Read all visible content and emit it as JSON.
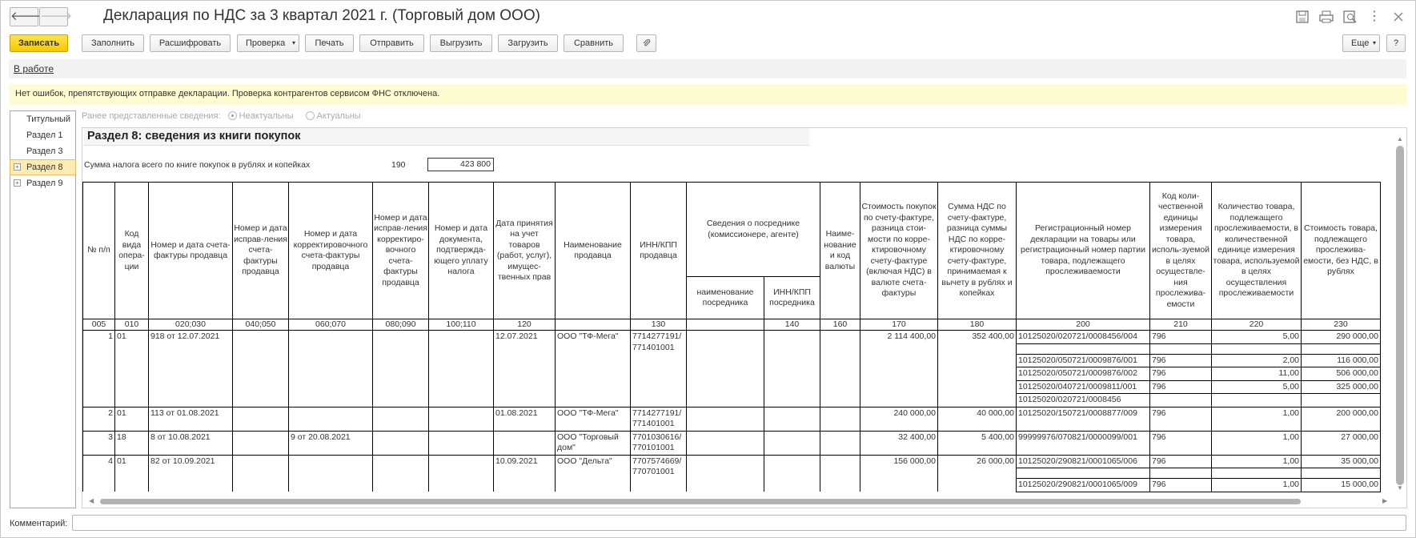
{
  "window": {
    "title": "Декларация по НДС за 3 квартал 2021 г. (Торговый дом ООО)",
    "back_glyph": "🡐",
    "forward_glyph": "🡒",
    "more_glyph": "⋮"
  },
  "toolbar": {
    "save": "Записать",
    "fill": "Заполнить",
    "decode": "Расшифровать",
    "check": "Проверка",
    "print": "Печать",
    "send": "Отправить",
    "export": "Выгрузить",
    "import": "Загрузить",
    "compare": "Сравнить",
    "more": "Еще",
    "help": "?",
    "accent": "#f5c800"
  },
  "status": {
    "link": "В работе",
    "notice": "Нет ошибок, препятствующих отправке декларации. Проверка контрагентов сервисом ФНС отключена."
  },
  "nav": {
    "items": [
      "Титульный",
      "Раздел 1",
      "Раздел 3",
      "Раздел 8",
      "Раздел 9"
    ]
  },
  "prev_info": {
    "label": "Ранее представленные сведения:",
    "opt1": "Неактуальны",
    "opt2": "Актуальны"
  },
  "section": {
    "title": "Раздел 8: сведения из книги покупок",
    "sum_label": "Сумма налога всего по книге покупок в рублях и копейках",
    "sum_code": "190",
    "sum_value": "423 800"
  },
  "table": {
    "headers": {
      "c1": "№ п/п",
      "c2": "Код вида опера-ции",
      "c3": "Номер и дата счета-фактуры продавца",
      "c4": "Номер и дата исправ-ления счета-фактуры продавца",
      "c5": "Номер и дата корректировочного счета-фактуры продавца",
      "c6": "Номер и дата исправ-ления корректиро-вочного счета-фактуры продавца",
      "c7": "Номер и дата документа, подтвержда-ющего уплату налога",
      "c8": "Дата принятия на учет товаров (работ, услуг), имущес-твенных прав",
      "c9": "Наименование продавца",
      "c10": "ИНН/КПП продавца",
      "c11": "Сведения о посреднике (комиссионере, агенте)",
      "c11a": "наименование посредника",
      "c11b": "ИНН/КПП посредника",
      "c12": "Наиме-нование и код валюты",
      "c13": "Стоимость покупок по счету-фактуре, разница стои-мости по корре-ктировочному счету-фактуре (включая НДС) в валюте счета-фактуры",
      "c14": "Сумма НДС по счету-фактуре, разница суммы НДС по корре-ктировочному счету-фактуре, принимаемая к вычету в рублях и копейках",
      "c15": "Регистрационный номер декларации на товары или регистрационный номер партии товара, подлежащего прослеживаемости",
      "c16": "Код коли-чественной единицы измерения товара, исполь-зуемой в целях осуществле-ния прослежива-емости",
      "c17": "Количество товара, подлежащего прослеживаемости, в количественной единице измерения товара, используемой в целях осуществления прослеживаемости",
      "c18": "Стоимость товара, подлежащего прослежива-емости, без НДС, в рублях"
    },
    "codes": [
      "005",
      "010",
      "020;030",
      "040;050",
      "060;070",
      "080;090",
      "100;110",
      "120",
      "",
      "130",
      "",
      "140",
      "160",
      "170",
      "180",
      "200",
      "210",
      "220",
      "230"
    ],
    "rows": [
      {
        "n": "1",
        "op": "01",
        "inv": "918 от 12.07.2021",
        "inv_fix": "",
        "corr": "",
        "corr_fix": "",
        "pay": "",
        "date": "12.07.2021",
        "seller": "ООО \"ТФ-Мега\"",
        "inn1": "7714277191/",
        "inn2": "771401001",
        "mname": "",
        "minn": "",
        "cur": "",
        "cost": "2 114 400,00",
        "vat": "352 400,00",
        "trace": [
          {
            "reg": "10125020/020721/0008456/004",
            "unit": "796",
            "qty": "5,00",
            "sum": "290 000,00"
          },
          {
            "reg": "",
            "unit": "",
            "qty": "",
            "sum": ""
          },
          {
            "reg": "10125020/050721/0009876/001",
            "unit": "796",
            "qty": "2,00",
            "sum": "116 000,00"
          },
          {
            "reg": "10125020/050721/0009876/002",
            "unit": "796",
            "qty": "11,00",
            "sum": "506 000,00"
          },
          {
            "reg": "10125020/040721/0009811/001",
            "unit": "796",
            "qty": "5,00",
            "sum": "325 000,00"
          },
          {
            "reg": "10125020/020721/0008456",
            "unit": "",
            "qty": "",
            "sum": ""
          }
        ]
      },
      {
        "n": "2",
        "op": "01",
        "inv": "113 от 01.08.2021",
        "inv_fix": "",
        "corr": "",
        "corr_fix": "",
        "pay": "",
        "date": "01.08.2021",
        "seller": "ООО \"ТФ-Мега\"",
        "inn1": "7714277191/",
        "inn2": "771401001",
        "mname": "",
        "minn": "",
        "cur": "",
        "cost": "240 000,00",
        "vat": "40 000,00",
        "trace": [
          {
            "reg": "10125020/150721/0008877/009",
            "unit": "796",
            "qty": "1,00",
            "sum": "200 000,00"
          }
        ]
      },
      {
        "n": "3",
        "op": "18",
        "inv": "8 от 10.08.2021",
        "inv_fix": "",
        "corr": "9 от 20.08.2021",
        "corr_fix": "",
        "pay": "",
        "date": "",
        "seller": "ООО \"Торговый",
        "seller2": "дом\"",
        "inn1": "7701030616/",
        "inn2": "770101001",
        "mname": "",
        "minn": "",
        "cur": "",
        "cost": "32 400,00",
        "vat": "5 400,00",
        "trace": [
          {
            "reg": "99999976/070821/0000099/001",
            "unit": "796",
            "qty": "1,00",
            "sum": "27 000,00"
          }
        ]
      },
      {
        "n": "4",
        "op": "01",
        "inv": "82 от 10.09.2021",
        "inv_fix": "",
        "corr": "",
        "corr_fix": "",
        "pay": "",
        "date": "10.09.2021",
        "seller": "ООО \"Дельта\"",
        "inn1": "7707574669/",
        "inn2": "770701001",
        "mname": "",
        "minn": "",
        "cur": "",
        "cost": "156 000,00",
        "vat": "26 000,00",
        "trace": [
          {
            "reg": "10125020/290821/0001065/006",
            "unit": "796",
            "qty": "1,00",
            "sum": "35 000,00"
          },
          {
            "reg": "",
            "unit": "",
            "qty": "",
            "sum": ""
          },
          {
            "reg": "10125020/290821/0001065/009",
            "unit": "796",
            "qty": "1,00",
            "sum": "15 000,00"
          }
        ]
      }
    ]
  },
  "comment": {
    "label": "Комментарий:",
    "value": ""
  }
}
